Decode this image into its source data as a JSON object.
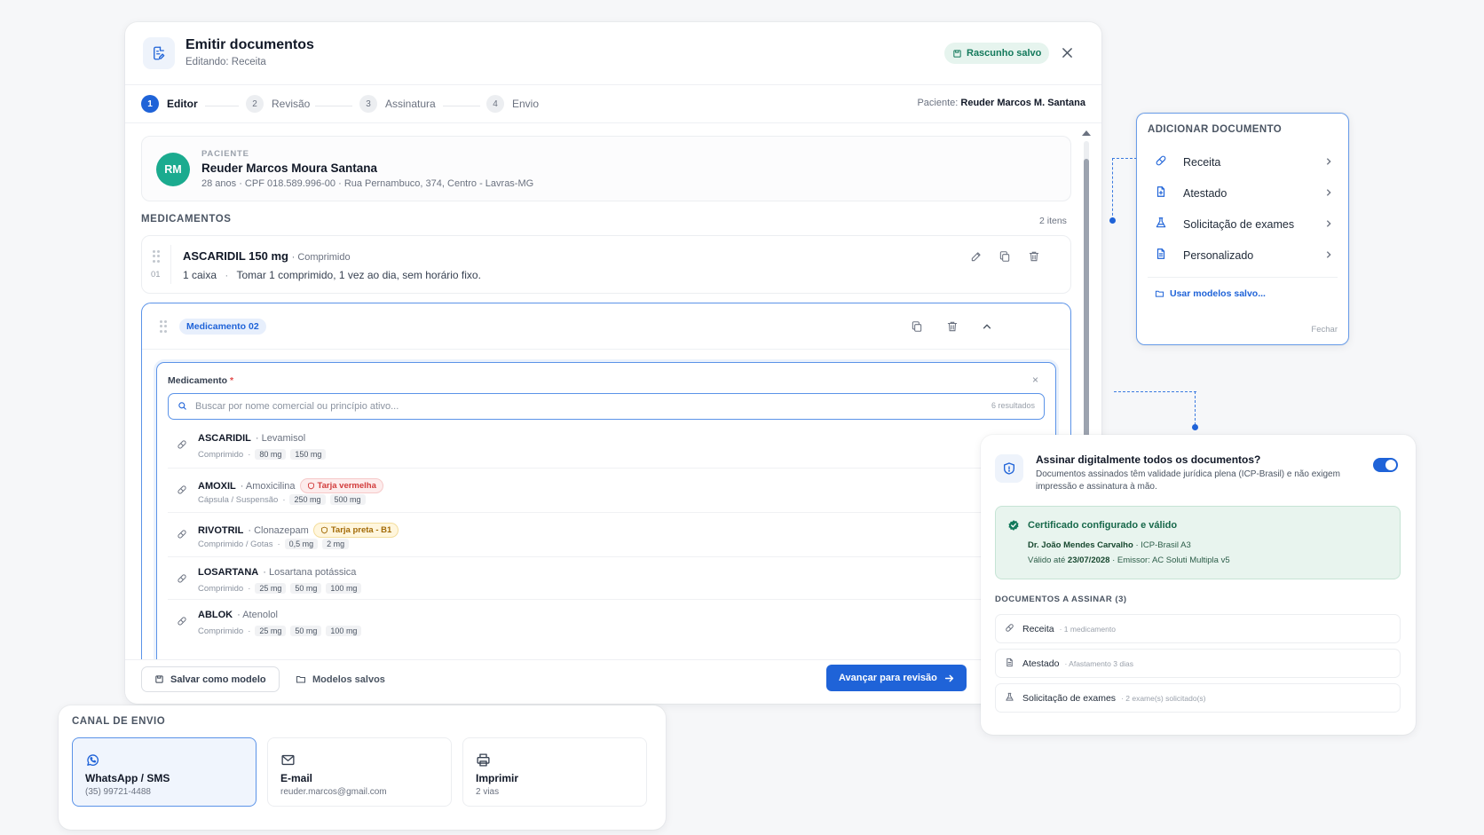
{
  "header": {
    "title": "Emitir documentos",
    "subtitle": "Editando: Receita",
    "draft_badge": "Rascunho salvo"
  },
  "stepper": {
    "steps": [
      {
        "num": "1",
        "label": "Editor"
      },
      {
        "num": "2",
        "label": "Revisão"
      },
      {
        "num": "3",
        "label": "Assinatura"
      },
      {
        "num": "4",
        "label": "Envio"
      }
    ],
    "patient_prefix": "Paciente:",
    "patient_name": "Reuder Marcos M. Santana"
  },
  "patient_card": {
    "initials": "RM",
    "label": "PACIENTE",
    "name": "Reuder Marcos Moura Santana",
    "info": "28 anos · CPF 018.589.996-00 · Rua Pernambuco, 374, Centro - Lavras-MG"
  },
  "medications": {
    "section_label": "MEDICAMENTOS",
    "count": "2 itens",
    "item1": {
      "index": "01",
      "name": "ASCARIDIL 150 mg",
      "form": "· Comprimido",
      "quantity": "1 caixa",
      "separator": "·",
      "posology": "Tomar 1 comprimido, 1 vez ao dia, sem horário fixo."
    },
    "item2_tag": "Medicamento 02",
    "field_label": "Medicamento",
    "required_mark": "*",
    "clear_label": "×",
    "search_placeholder": "Buscar por nome comercial ou princípio ativo...",
    "results_count": "6 resultados",
    "results": [
      {
        "name": "ASCARIDIL",
        "active": "· Levamisol",
        "warning": "",
        "form": "Comprimido",
        "doses": [
          "80 mg",
          "150 mg"
        ]
      },
      {
        "name": "AMOXIL",
        "active": "· Amoxicilina",
        "warning": "Tarja vermelha",
        "warning_type": "red",
        "form": "Cápsula / Suspensão",
        "doses": [
          "250 mg",
          "500 mg"
        ]
      },
      {
        "name": "RIVOTRIL",
        "active": "· Clonazepam",
        "warning": "Tarja preta - B1",
        "warning_type": "yellow",
        "form": "Comprimido / Gotas",
        "doses": [
          "0,5 mg",
          "2 mg"
        ]
      },
      {
        "name": "LOSARTANA",
        "active": "· Losartana potássica",
        "warning": "",
        "form": "Comprimido",
        "doses": [
          "25 mg",
          "50 mg",
          "100 mg"
        ]
      },
      {
        "name": "ABLOK",
        "active": "· Atenolol",
        "warning": "",
        "form": "Comprimido",
        "doses": [
          "25 mg",
          "50 mg",
          "100 mg"
        ]
      }
    ]
  },
  "footer": {
    "save_template": "Salvar como modelo",
    "saved_templates": "Modelos salvos",
    "next": "Avançar para revisão"
  },
  "add_document": {
    "title": "ADICIONAR DOCUMENTO",
    "items": [
      {
        "label": "Receita",
        "icon": "pill-icon"
      },
      {
        "label": "Atestado",
        "icon": "document-plus-icon"
      },
      {
        "label": "Solicitação de exames",
        "icon": "flask-icon"
      },
      {
        "label": "Personalizado",
        "icon": "document-icon"
      }
    ],
    "templates_link": "Usar modelos salvo...",
    "close": "Fechar"
  },
  "sign": {
    "title": "Assinar digitalmente todos os documentos?",
    "description": "Documentos assinados têm validade jurídica plena (ICP-Brasil) e não exigem impressão e assinatura à mão.",
    "toggle_on": true,
    "cert_title": "Certificado configurado e válido",
    "cert_doctor": "Dr. João Mendes Carvalho",
    "cert_type": "· ICP-Brasil A3",
    "cert_valid_prefix": "Válido até",
    "cert_valid_date": "23/07/2028",
    "cert_issuer": "· Emissor: AC Soluti Multipla v5",
    "docs_label": "DOCUMENTOS A ASSINAR (3)",
    "docs": [
      {
        "name": "Receita",
        "detail": "· 1 medicamento",
        "icon": "pill-icon"
      },
      {
        "name": "Atestado",
        "detail": "· Afastamento 3 dias",
        "icon": "document-icon"
      },
      {
        "name": "Solicitação de exames",
        "detail": "· 2 exame(s) solicitado(s)",
        "icon": "flask-icon"
      }
    ]
  },
  "channel": {
    "title": "CANAL DE ENVIO",
    "options": [
      {
        "name": "WhatsApp / SMS",
        "detail": "(35) 99721-4488",
        "icon": "whatsapp-icon",
        "selected": true
      },
      {
        "name": "E-mail",
        "detail": "reuder.marcos@gmail.com",
        "icon": "mail-icon",
        "selected": false
      },
      {
        "name": "Imprimir",
        "detail": "2 vias",
        "icon": "printer-icon",
        "selected": false
      }
    ]
  },
  "colors": {
    "primary": "#1f63d8",
    "success": "#13795b",
    "danger": "#d23c3c",
    "warning": "#a26a06"
  }
}
